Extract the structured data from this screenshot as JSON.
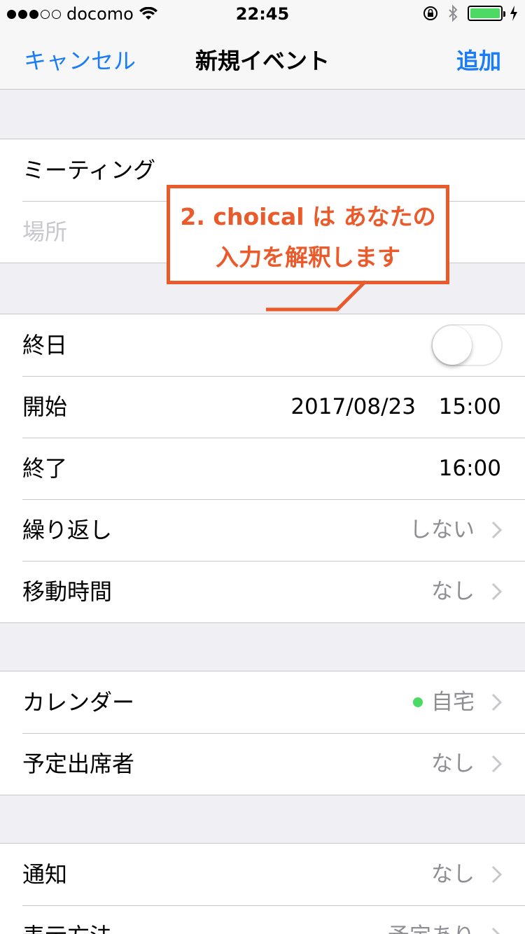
{
  "status_bar": {
    "carrier": "docomo",
    "time": "22:45"
  },
  "nav": {
    "cancel_label": "キャンセル",
    "title": "新規イベント",
    "add_label": "追加"
  },
  "event": {
    "title_value": "ミーティング",
    "location_placeholder": "場所"
  },
  "schedule": {
    "all_day_label": "終日",
    "all_day_enabled": false,
    "start_label": "開始",
    "start_date": "2017/08/23",
    "start_time": "15:00",
    "end_label": "終了",
    "end_time": "16:00",
    "repeat_label": "繰り返し",
    "repeat_value": "しない",
    "travel_label": "移動時間",
    "travel_value": "なし"
  },
  "calendar": {
    "calendar_label": "カレンダー",
    "calendar_value": "自宅",
    "calendar_color": "#4cd964",
    "invitees_label": "予定出席者",
    "invitees_value": "なし"
  },
  "alerts": {
    "alert_label": "通知",
    "alert_value": "なし",
    "show_as_label": "表示方法",
    "show_as_value": "予定あり"
  },
  "annotation": {
    "line1": "2. choical は あなたの",
    "line2": "入力を解釈します",
    "color": "#ea5a2a"
  },
  "colors": {
    "accent": "#1a7cf7",
    "battery": "#4cd964"
  }
}
